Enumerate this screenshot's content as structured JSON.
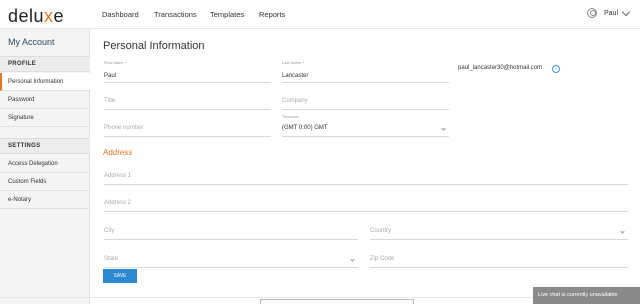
{
  "header": {
    "logo_prefix": "delu",
    "logo_x": "x",
    "logo_suffix": "e",
    "nav": [
      "Dashboard",
      "Transactions",
      "Templates",
      "Reports"
    ],
    "user_name": "Paul"
  },
  "sidebar": {
    "title": "My Account",
    "sections": [
      {
        "label": "PROFILE",
        "items": [
          "Personal Information",
          "Password",
          "Signature"
        ]
      },
      {
        "label": "SETTINGS",
        "items": [
          "Access Delegation",
          "Custom Fields",
          "e-Notary"
        ]
      }
    ],
    "active_item": "Personal Information"
  },
  "main": {
    "title": "Personal Information",
    "first_name": {
      "label": "First Name *",
      "value": "Paul"
    },
    "last_name": {
      "label": "Last Name *",
      "value": "Lancaster"
    },
    "email": "paul_lancaster30@hotmail.com",
    "title_field": {
      "placeholder": "Title"
    },
    "company": {
      "placeholder": "Company"
    },
    "phone": {
      "placeholder": "Phone number"
    },
    "timezone": {
      "label": "Timezone",
      "value": "(GMT 0:00) GMT"
    },
    "address_heading": "Address",
    "address1": {
      "placeholder": "Address 1"
    },
    "address2": {
      "placeholder": "Address 2"
    },
    "city": {
      "placeholder": "City"
    },
    "country": {
      "placeholder": "Country"
    },
    "state": {
      "placeholder": "State"
    },
    "zip": {
      "placeholder": "Zip Code"
    },
    "save_label": "SAVE"
  },
  "live_chat": "Live chat is currently unavailable",
  "colors": {
    "accent": "#e87722",
    "primary": "#2d89cf"
  }
}
